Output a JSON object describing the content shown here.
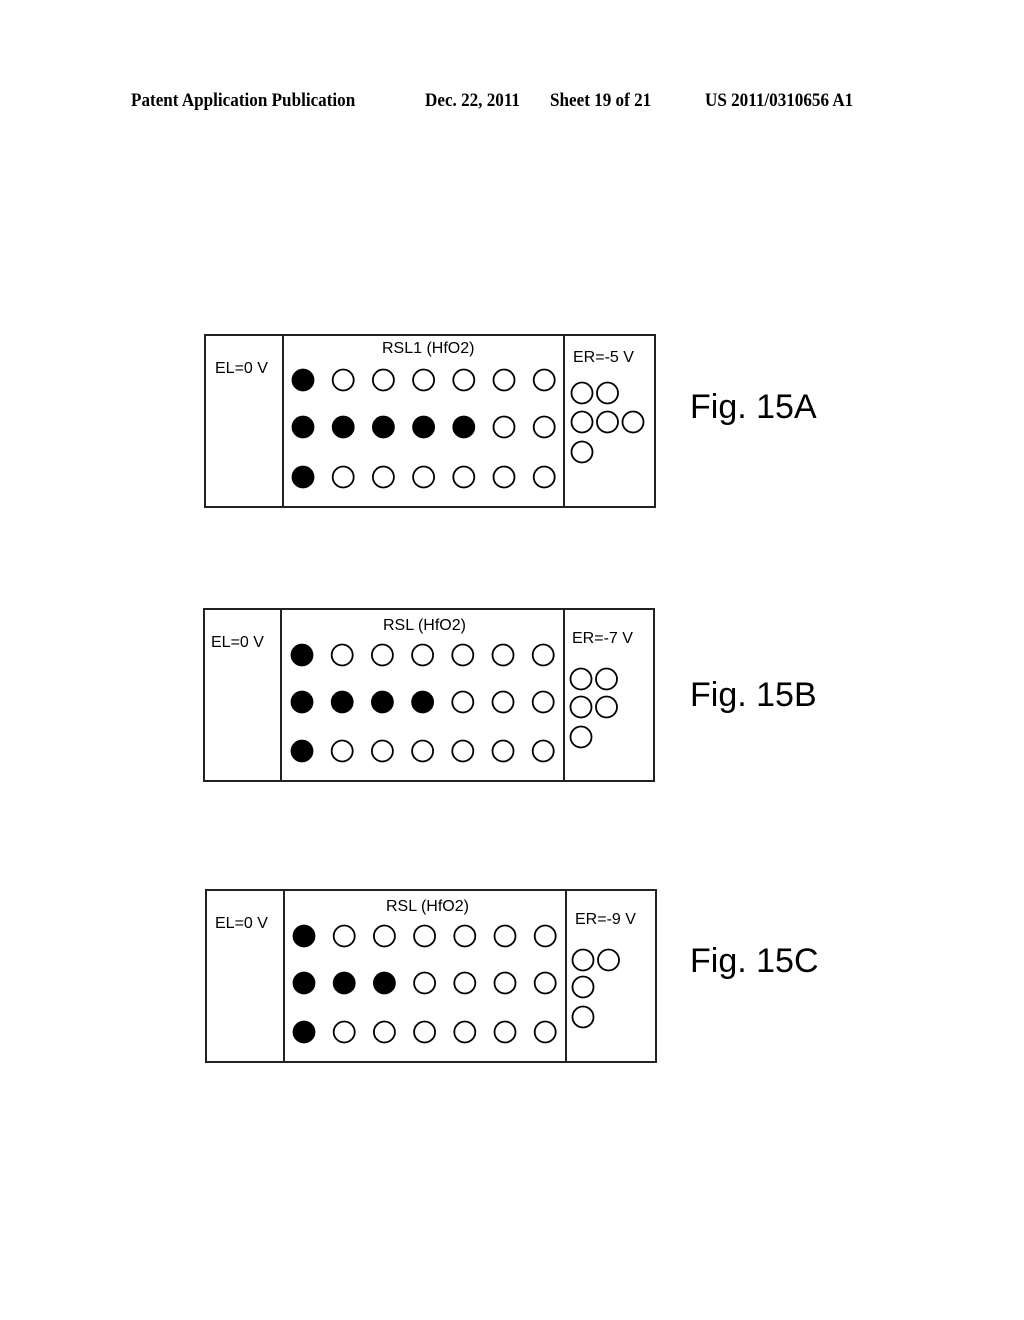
{
  "header": {
    "publication": "Patent Application Publication",
    "date": "Dec. 22, 2011",
    "sheet": "Sheet 19 of 21",
    "number": "US 2011/0310656 A1"
  },
  "figures": [
    {
      "label": "Fig. 15A",
      "left_electrode": "EL=0 V",
      "layer": "RSL1 (HfO2)",
      "right_electrode": "ER=-5 V",
      "grid_filled_per_row": [
        1,
        5,
        1
      ],
      "grid_columns": 7,
      "right_circles_rows": [
        2,
        3,
        1
      ]
    },
    {
      "label": "Fig. 15B",
      "left_electrode": "EL=0 V",
      "layer": "RSL (HfO2)",
      "right_electrode": "ER=-7 V",
      "grid_filled_per_row": [
        1,
        4,
        1
      ],
      "grid_columns": 7,
      "right_circles_rows": [
        2,
        2,
        1
      ]
    },
    {
      "label": "Fig. 15C",
      "left_electrode": "EL=0 V",
      "layer": "RSL (HfO2)",
      "right_electrode": "ER=-9 V",
      "grid_filled_per_row": [
        1,
        3,
        1
      ],
      "grid_columns": 7,
      "right_circles_rows": [
        2,
        1,
        1
      ]
    }
  ]
}
